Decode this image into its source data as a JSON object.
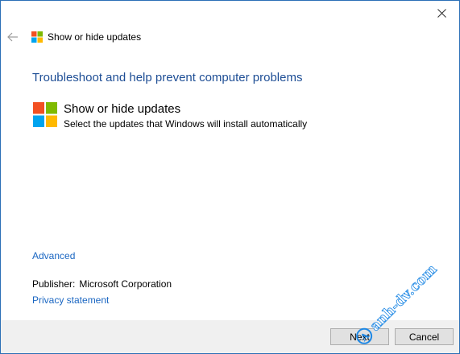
{
  "window": {
    "close_glyph": "✕",
    "back_glyph": "←",
    "title": "Show or hide updates"
  },
  "main": {
    "heading": "Troubleshoot and help prevent computer problems",
    "tool_title": "Show or hide updates",
    "tool_description": "Select the updates that Windows will install automatically",
    "advanced_link": "Advanced",
    "publisher_label": "Publisher:",
    "publisher_value": "Microsoft Corporation",
    "privacy_link": "Privacy statement"
  },
  "footer": {
    "next_label": "Next",
    "cancel_label": "Cancel"
  },
  "watermark": {
    "text": "anh-dv.com",
    "badge_letter": "A"
  },
  "colors": {
    "heading_blue": "#1e4e95",
    "link_blue": "#1a66c2",
    "logo_red": "#f25022",
    "logo_green": "#7fba00",
    "logo_blue": "#00a4ef",
    "logo_yellow": "#ffb900",
    "watermark_blue": "#1e88e5"
  },
  "icons": {
    "close": "close-icon",
    "back": "back-arrow-icon",
    "logo": "windows-logo-icon"
  }
}
